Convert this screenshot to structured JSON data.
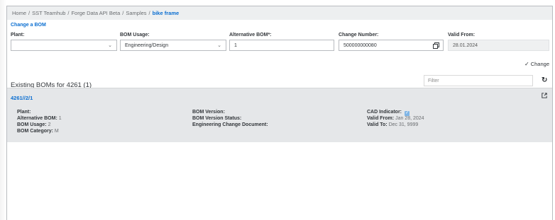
{
  "breadcrumb": {
    "items": [
      "Home",
      "SST Teamhub",
      "Forge Data API Beta",
      "Samples"
    ],
    "current": "bike frame",
    "separator": "/"
  },
  "form": {
    "title": "Change a BOM",
    "plant": {
      "label": "Plant:",
      "value": ""
    },
    "bom_usage": {
      "label": "BOM Usage:",
      "value": "Engineering/Design"
    },
    "alternative_bom": {
      "label": "Alternative BOM*:",
      "value": "1"
    },
    "change_number": {
      "label": "Change Number:",
      "value": "500000000080"
    },
    "valid_from": {
      "label": "Valid From:",
      "value": "28.01.2024"
    },
    "change_button": "Change"
  },
  "list": {
    "header": "Existing BOMs for 4261 (1)",
    "filter_placeholder": "Filter",
    "items": [
      {
        "title": "4261//2/1",
        "plant_label": "Plant:",
        "plant_value": "",
        "alt_bom_label": "Alternative BOM:",
        "alt_bom_value": "1",
        "usage_label": "BOM Usage:",
        "usage_value": "2",
        "category_label": "BOM Category:",
        "category_value": "M",
        "version_label": "BOM Version:",
        "version_value": "",
        "version_status_label": "BOM Version Status:",
        "version_status_value": "",
        "ecd_label": "Engineering Change Document:",
        "ecd_value": "",
        "cad_label": "CAD Indicator:",
        "cad_checked": true,
        "valid_from_label": "Valid From:",
        "valid_from_value": "Jan 28, 2024",
        "valid_to_label": "Valid To:",
        "valid_to_value": "Dec 31, 9999"
      }
    ]
  },
  "colors": {
    "accent": "#0a6ed1",
    "item_bg": "#e5e7e9",
    "breadcrumb_bg": "#edeff0"
  }
}
